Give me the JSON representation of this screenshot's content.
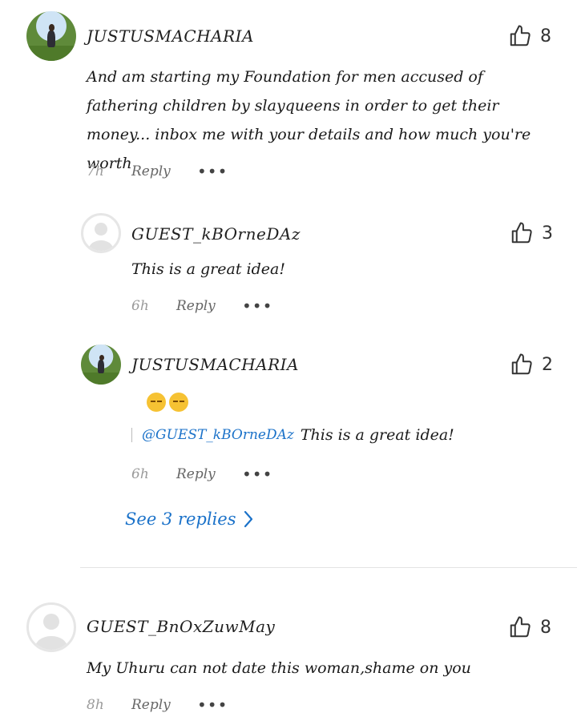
{
  "comments": [
    {
      "username": "JUSTUSMACHARIA",
      "likes": "8",
      "text": "And am starting my Foundation for men accused of fathering children by slayqueens in order to get their money... inbox me with your details and how much you're worth",
      "time": "7h",
      "reply_label": "Reply",
      "more_label": "•••",
      "avatar": "photo-avatar"
    },
    {
      "username": "GUEST_kBOrneDAz",
      "likes": "3",
      "text": "This is a great idea!",
      "time": "6h",
      "reply_label": "Reply",
      "more_label": "•••",
      "avatar": "default-avatar"
    },
    {
      "username": "JUSTUSMACHARIA",
      "likes": "2",
      "emoji": "hands-over-face-emoji",
      "quote_mention": "@GUEST_kBOrneDAz",
      "quote_text": "This is a great idea!",
      "time": "6h",
      "reply_label": "Reply",
      "more_label": "•••",
      "avatar": "photo-avatar"
    },
    {
      "username": "GUEST_BnOxZuwMay",
      "likes": "8",
      "text": "My Uhuru can not date this woman,shame on you",
      "time": "8h",
      "reply_label": "Reply",
      "more_label": "•••",
      "avatar": "default-avatar"
    }
  ],
  "see_replies": {
    "label": "See 3 replies",
    "icon": "chevron-right-icon"
  },
  "colors": {
    "link": "#1b72c9",
    "muted": "#9a9a9a"
  }
}
